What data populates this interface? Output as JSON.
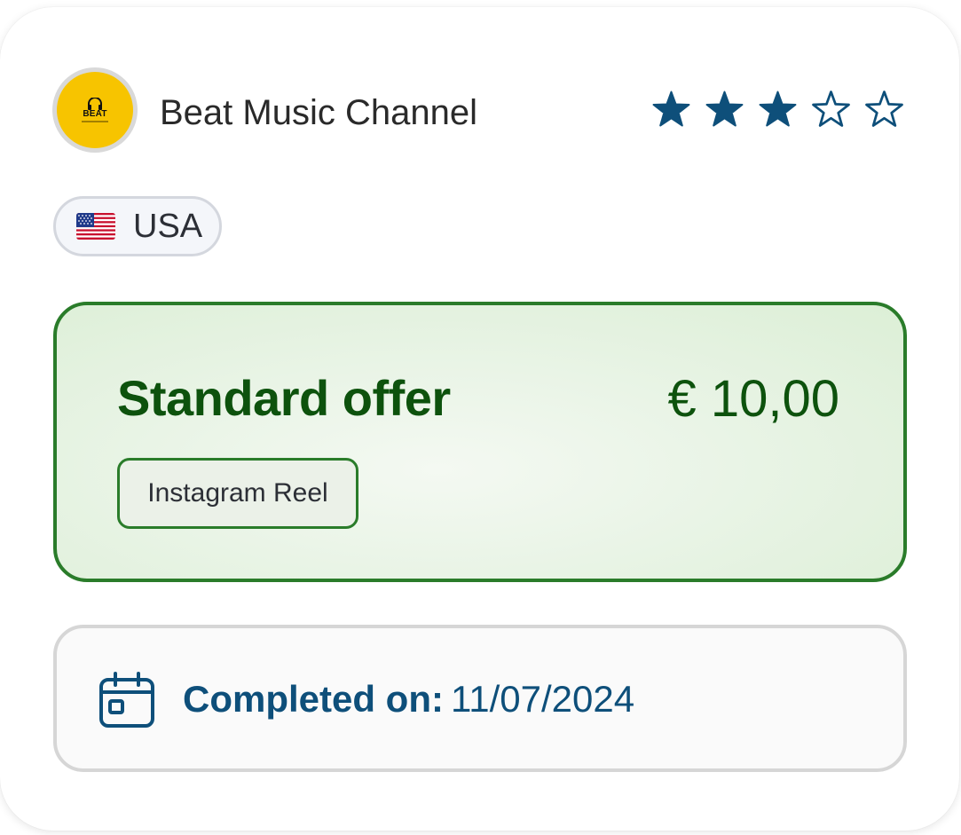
{
  "channel": {
    "name": "Beat Music Channel",
    "avatar_text": "BEAT",
    "avatar_icon": "headphones-icon",
    "rating": 3,
    "rating_max": 5
  },
  "country": {
    "label": "USA",
    "flag": "us-flag-icon"
  },
  "offer": {
    "title": "Standard offer",
    "price": "€ 10,00",
    "type_label": "Instagram Reel"
  },
  "completion": {
    "label": "Completed on:",
    "date": "11/07/2024",
    "icon": "calendar-icon"
  },
  "colors": {
    "star": "#0e4f7a",
    "offer_green": "#0d520d",
    "offer_border": "#2a7c2a",
    "completed_blue": "#0e4f7a",
    "avatar_yellow": "#f7c400"
  }
}
